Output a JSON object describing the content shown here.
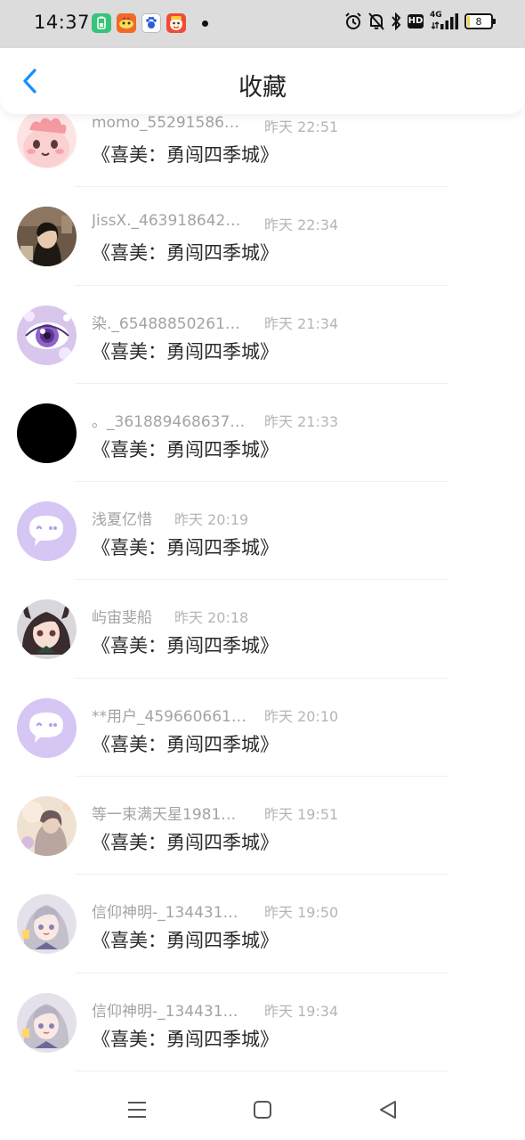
{
  "status_bar": {
    "time": "14:37",
    "network": "4G",
    "hd_label": "HD",
    "battery_level": "8",
    "battery_fraction": 0.08,
    "app_icons": [
      "battery-saver-icon",
      "taobao-icon",
      "baidu-icon",
      "game-icon"
    ]
  },
  "header": {
    "title": "收藏",
    "back_icon": "chevron-left-icon",
    "accent_color": "#1a8cff"
  },
  "items": [
    {
      "name": "momo_55291586…",
      "time": "昨天 22:51",
      "message": "《喜美：勇闯四季城》",
      "avatar": "pink-blob"
    },
    {
      "name": "JissX._463918642…",
      "time": "昨天 22:34",
      "message": "《喜美：勇闯四季城》",
      "avatar": "photo-girl"
    },
    {
      "name": "染._65488850261…",
      "time": "昨天 21:34",
      "message": "《喜美：勇闯四季城》",
      "avatar": "purple-eye"
    },
    {
      "name": "。_361889468637…",
      "time": "昨天 21:33",
      "message": "《喜美：勇闯四季城》",
      "avatar": "black"
    },
    {
      "name": "浅夏亿惜",
      "time": "昨天 20:19",
      "message": "《喜美：勇闯四季城》",
      "avatar": "default-chat"
    },
    {
      "name": "屿宙斐船",
      "time": "昨天 20:18",
      "message": "《喜美：勇闯四季城》",
      "avatar": "anime-girl"
    },
    {
      "name": "**用户_459660661…",
      "time": "昨天 20:10",
      "message": "《喜美：勇闯四季城》",
      "avatar": "default-chat"
    },
    {
      "name": "等一束满天星1981…",
      "time": "昨天 19:51",
      "message": "《喜美：勇闯四季城》",
      "avatar": "soft-photo"
    },
    {
      "name": "信仰神明-_134431…",
      "time": "昨天 19:50",
      "message": "《喜美：勇闯四季城》",
      "avatar": "anime-silver"
    },
    {
      "name": "信仰神明-_134431…",
      "time": "昨天 19:34",
      "message": "《喜美：勇闯四季城》",
      "avatar": "anime-silver"
    }
  ],
  "nav_bar": {
    "menu_icon": "menu-icon",
    "home_icon": "home-square-icon",
    "back_icon": "back-triangle-icon"
  }
}
